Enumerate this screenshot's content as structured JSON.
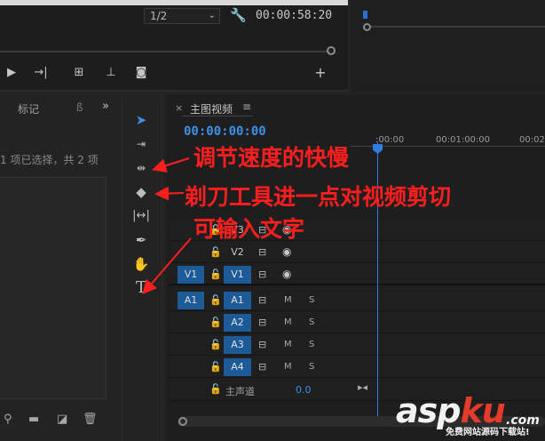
{
  "monitor": {
    "zoom": "1/2",
    "timecode": "00:00:58:20",
    "buttons": [
      {
        "name": "play-button",
        "icon": "▶"
      },
      {
        "name": "step-into-button",
        "icon": "→|"
      },
      {
        "name": "lift-button",
        "icon": "⛫"
      },
      {
        "name": "extract-button",
        "icon": "⏏"
      },
      {
        "name": "export-frame-button",
        "icon": "📷"
      },
      {
        "name": "add-button",
        "icon": "+"
      }
    ]
  },
  "project": {
    "tab_label": "标记",
    "tab_sep": "ß",
    "more": "»",
    "selection_info": "1 项已选择，共 2 项"
  },
  "timeline": {
    "title": "主图视频",
    "menu": "≡",
    "close": "×",
    "timecode": "00:00:00:00",
    "ruler": [
      ":00:00",
      "00:01:00:00",
      "00:02"
    ],
    "master_label": "主声道",
    "master_value": "0.0"
  },
  "tracks": [
    {
      "label": "V3",
      "type": "video",
      "target": false,
      "source": ""
    },
    {
      "label": "V2",
      "type": "video",
      "target": false,
      "source": ""
    },
    {
      "label": "V1",
      "type": "video",
      "target": true,
      "source": "V1"
    },
    {
      "label": "A1",
      "type": "audio",
      "target": true,
      "source": "A1"
    },
    {
      "label": "A2",
      "type": "audio",
      "target": true,
      "source": ""
    },
    {
      "label": "A3",
      "type": "audio",
      "target": true,
      "source": ""
    },
    {
      "label": "A4",
      "type": "audio",
      "target": true,
      "source": ""
    }
  ],
  "track_glyphs": {
    "mute": "M",
    "solo": "S",
    "lock": "🔓",
    "sync": "⊟",
    "eye": "◉"
  },
  "annotations": {
    "speed": "调节速度的快慢",
    "razor": "剃刀工具进一点对视频剪切",
    "type": "可输入文字"
  },
  "watermark": {
    "logo_a": "asp",
    "logo_b": "ku",
    "logo_c": ".com",
    "sub": "免费网站源码下载站!"
  }
}
